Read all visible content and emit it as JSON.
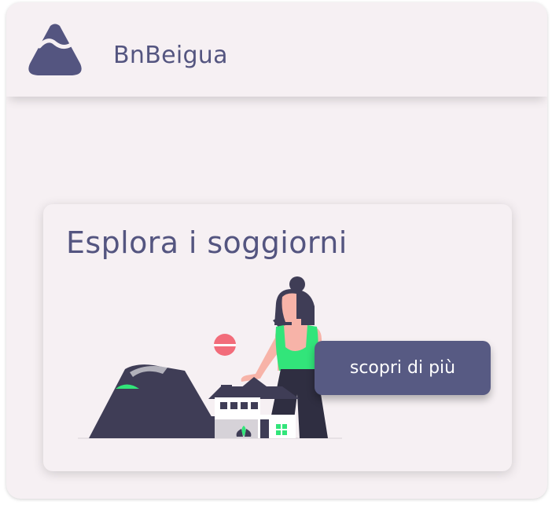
{
  "header": {
    "logo_icon": "mountain-logo-icon",
    "app_name": "BnBeigua"
  },
  "card": {
    "title": "Esplora i soggiorni",
    "illustration": "woman-house-mountain-illustration",
    "cta_label": "scopri di più"
  },
  "colors": {
    "background": "#f6f0f3",
    "primary": "#545580",
    "button": "#575a83",
    "accent_green": "#32e57a",
    "accent_red": "#f26c7a",
    "dark": "#3f3d56"
  }
}
